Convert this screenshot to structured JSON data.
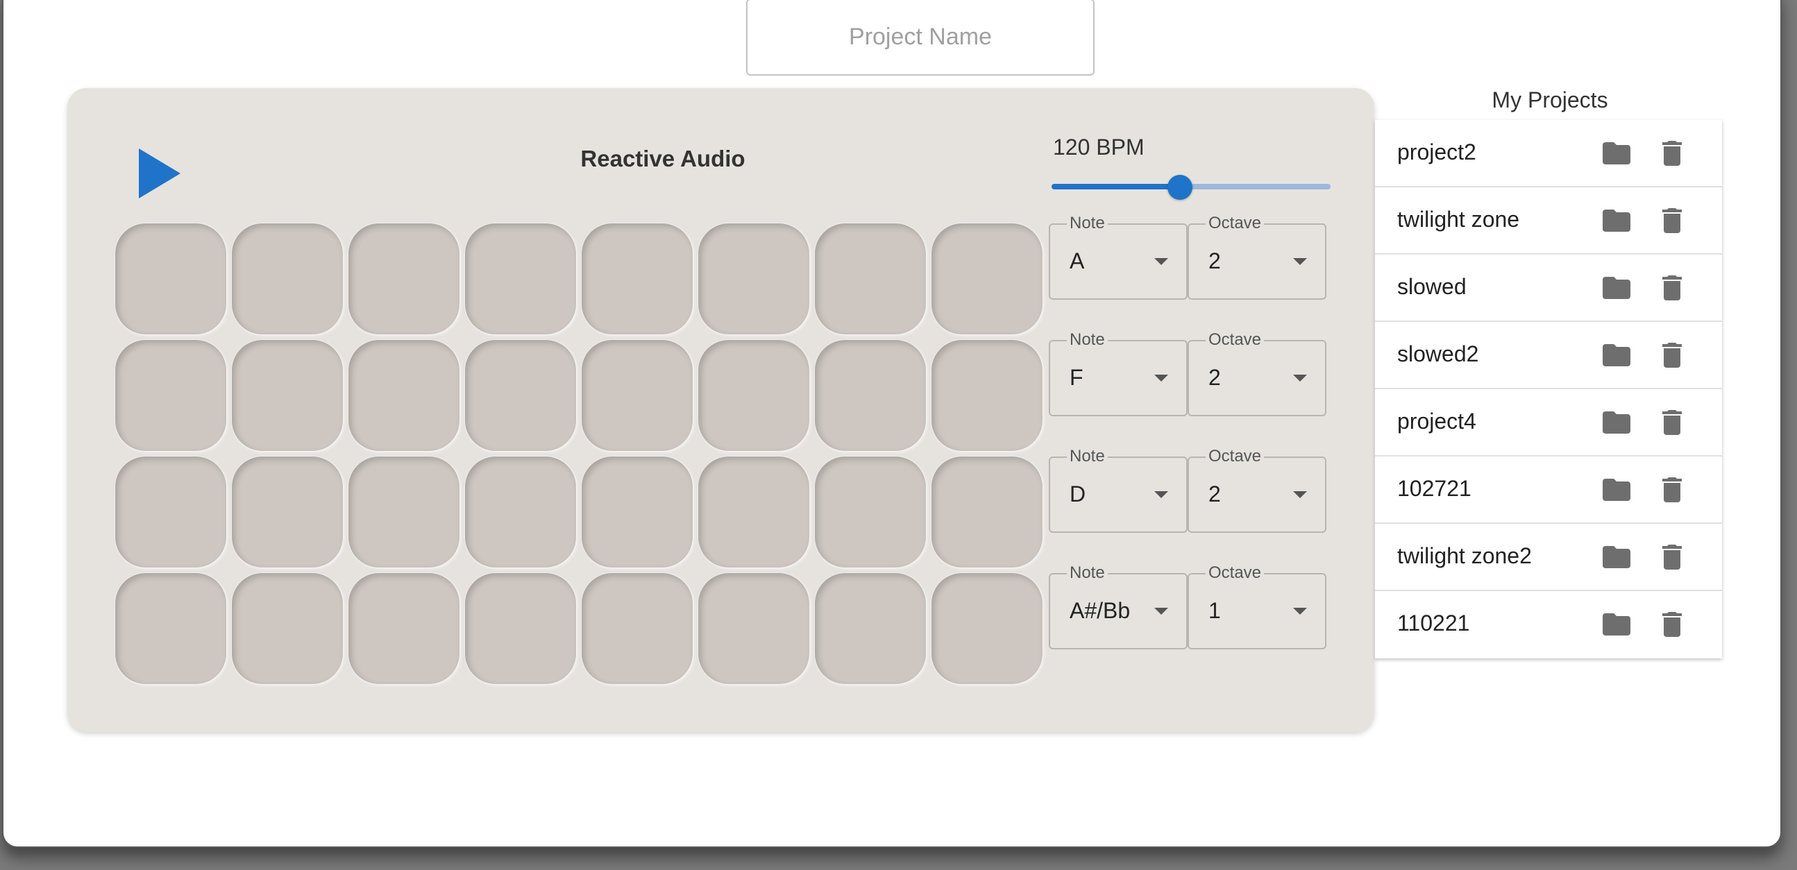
{
  "project_name": {
    "placeholder": "Project Name",
    "value": ""
  },
  "sequencer": {
    "title": "Reactive Audio",
    "play_icon": "play-icon",
    "bpm_label": "120 BPM",
    "bpm_value": 120,
    "bpm_fraction": 0.46,
    "rows": [
      {
        "note_label": "Note",
        "note": "A",
        "octave_label": "Octave",
        "octave": "2"
      },
      {
        "note_label": "Note",
        "note": "F",
        "octave_label": "Octave",
        "octave": "2"
      },
      {
        "note_label": "Note",
        "note": "D",
        "octave_label": "Octave",
        "octave": "2"
      },
      {
        "note_label": "Note",
        "note": "A#/Bb",
        "octave_label": "Octave",
        "octave": "1"
      }
    ],
    "steps_per_row": 8
  },
  "my_projects": {
    "title": "My Projects",
    "items": [
      {
        "name": "project2"
      },
      {
        "name": "twilight zone"
      },
      {
        "name": "slowed"
      },
      {
        "name": "slowed2"
      },
      {
        "name": "project4"
      },
      {
        "name": "102721"
      },
      {
        "name": "twilight zone2"
      },
      {
        "name": "110221"
      }
    ],
    "open_icon": "folder-icon",
    "delete_icon": "trash-icon"
  },
  "colors": {
    "accent": "#1f73c9",
    "panel": "#e6e3df",
    "pad": "#cdc6c1",
    "icon": "#6e6e6e"
  }
}
